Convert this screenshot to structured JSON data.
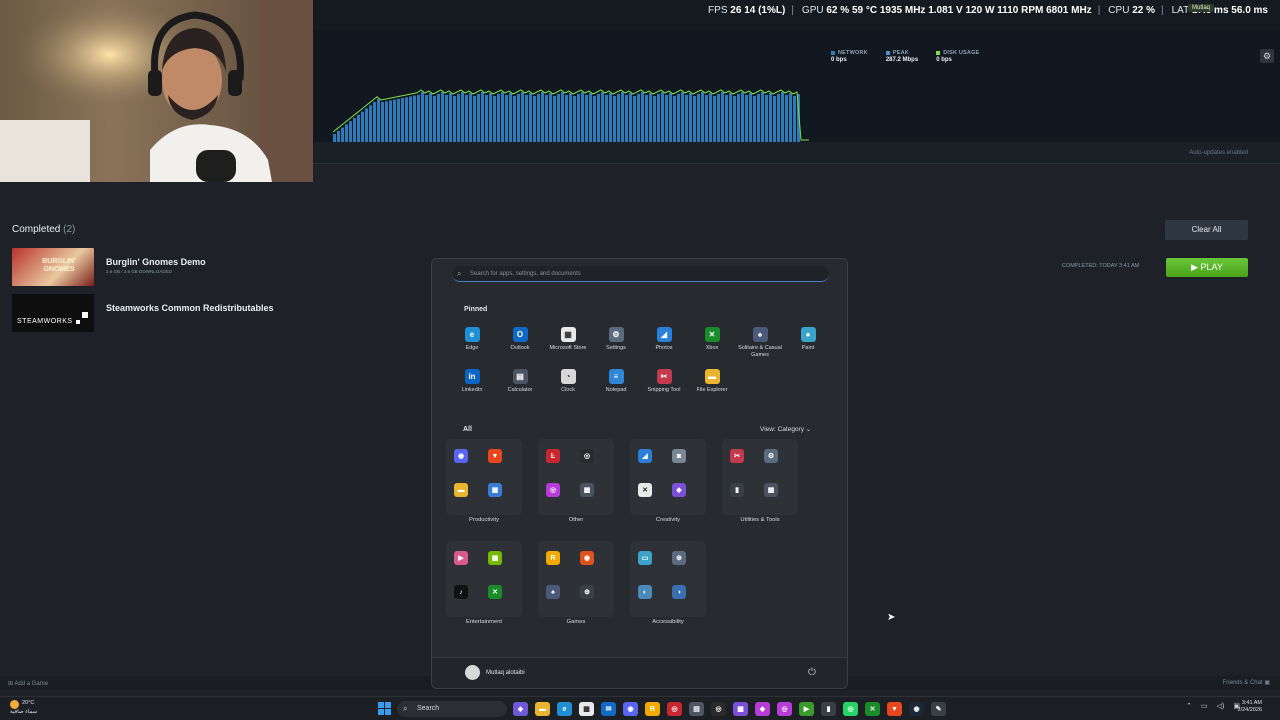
{
  "overlay": {
    "fps_label": "FPS",
    "fps_value": "26",
    "fps_low": "14 (1%L)",
    "gpu_label": "GPU",
    "gpu_usage": "62 %",
    "gpu_temp": "59 °C",
    "gpu_clock": "1935 MHz",
    "gpu_volt": "1.081 V",
    "gpu_power": "120 W",
    "gpu_fan": "1110 RPM",
    "gpu_mem": "6801 MHz",
    "cpu_label": "CPU",
    "cpu_usage": "22 %",
    "lat_label": "LAT",
    "lat_1": "17.8 ms",
    "lat_2": "56.0 ms",
    "user_badge": "Mutlaq"
  },
  "stats": {
    "network_label": "NETWORK",
    "network_value": "0 bps",
    "peak_label": "PEAK",
    "peak_value": "287.2 Mbps",
    "disk_label": "DISK USAGE",
    "disk_value": "0 bps",
    "auto_updates": "Auto-updates enabled"
  },
  "downloads": {
    "completed_label": "Completed",
    "completed_count": "(2)",
    "clear_all": "Clear All",
    "completed_time": "COMPLETED: TODAY 3:41 AM",
    "play_label": "PLAY",
    "items": [
      {
        "name": "Burglin' Gnomes Demo",
        "size": "2.6 GB / 2.6 GB DOWNLOADED",
        "thumb_text": "BURGLIN' GNOMES"
      },
      {
        "name": "Steamworks Common Redistributables",
        "size": "",
        "thumb_text": "STEAMWORKS"
      }
    ],
    "add_game": "Add a Game",
    "friends_chat": "Friends & Chat"
  },
  "start_menu": {
    "search_placeholder": "Search for apps, settings, and documents",
    "pinned_label": "Pinned",
    "pinned": [
      {
        "name": "Edge",
        "icon": "edge-icon",
        "color": "#1f8fd6",
        "glyph": "e"
      },
      {
        "name": "Outlook",
        "icon": "outlook-icon",
        "color": "#1169c6",
        "glyph": "O"
      },
      {
        "name": "Microsoft Store",
        "icon": "store-icon",
        "color": "#e8e8e8",
        "glyph": "▦"
      },
      {
        "name": "Settings",
        "icon": "gear-icon",
        "color": "#5a6b80",
        "glyph": "⚙"
      },
      {
        "name": "Photos",
        "icon": "photos-icon",
        "color": "#2a7fd8",
        "glyph": "◢"
      },
      {
        "name": "Xbox",
        "icon": "xbox-icon",
        "color": "#1a8c2a",
        "glyph": "✕"
      },
      {
        "name": "Solitaire & Casual Games",
        "icon": "solitaire-icon",
        "color": "#4a5a7a",
        "glyph": "♠"
      },
      {
        "name": "Paint",
        "icon": "paint-icon",
        "color": "#3aa3c9",
        "glyph": "●"
      },
      {
        "name": "LinkedIn",
        "icon": "linkedin-icon",
        "color": "#0a66c2",
        "glyph": "in"
      },
      {
        "name": "Calculator",
        "icon": "calculator-icon",
        "color": "#4b5563",
        "glyph": "▤"
      },
      {
        "name": "Clock",
        "icon": "clock-icon",
        "color": "#d8d8d8",
        "glyph": "◔"
      },
      {
        "name": "Notepad",
        "icon": "notepad-icon",
        "color": "#2f86d6",
        "glyph": "≡"
      },
      {
        "name": "Snipping Tool",
        "icon": "snipping-icon",
        "color": "#c23a4b",
        "glyph": "✂"
      },
      {
        "name": "File Explorer",
        "icon": "folder-icon",
        "color": "#e9b530",
        "glyph": "▬"
      }
    ],
    "all_label": "All",
    "view_label": "View: Category",
    "categories": [
      {
        "name": "Productivity",
        "apps": [
          {
            "icon": "discord-icon",
            "color": "#5865f2",
            "glyph": "◉"
          },
          {
            "icon": "brave-icon",
            "color": "#e8461d",
            "glyph": "▼"
          },
          {
            "icon": "folder-icon",
            "color": "#e9b530",
            "glyph": "▬"
          },
          {
            "icon": "widgets-icon",
            "color": "#3a7bd5",
            "glyph": "▦"
          }
        ]
      },
      {
        "name": "Other",
        "apps": [
          {
            "icon": "app-red-icon",
            "color": "#c9272f",
            "glyph": "Ŀ"
          },
          {
            "icon": "obs-icon",
            "color": "#2a2a2a",
            "glyph": "◎"
          },
          {
            "icon": "app-purple-icon",
            "color": "#b63bd8",
            "glyph": "◎"
          },
          {
            "icon": "app-grid-icon",
            "color": "#4a5360",
            "glyph": "▩"
          }
        ]
      },
      {
        "name": "Creativity",
        "apps": [
          {
            "icon": "photos-icon",
            "color": "#2a7fd8",
            "glyph": "◢"
          },
          {
            "icon": "camera-icon",
            "color": "#7a8694",
            "glyph": "◙"
          },
          {
            "icon": "capcut-icon",
            "color": "#e8e8e8",
            "glyph": "✕"
          },
          {
            "icon": "clipchamp-icon",
            "color": "#7b4fd8",
            "glyph": "◆"
          }
        ]
      },
      {
        "name": "Utilities & Tools",
        "apps": [
          {
            "icon": "snipping-icon",
            "color": "#c23a4b",
            "glyph": "✂"
          },
          {
            "icon": "gear-icon",
            "color": "#5a6b80",
            "glyph": "⚙"
          },
          {
            "icon": "mouse-icon",
            "color": "#3a3f45",
            "glyph": "▮"
          },
          {
            "icon": "control-icon",
            "color": "#4a5360",
            "glyph": "▦"
          }
        ]
      },
      {
        "name": "Entertainment",
        "apps": [
          {
            "icon": "media-player-icon",
            "color": "#d65a8a",
            "glyph": "▶"
          },
          {
            "icon": "nvidia-icon",
            "color": "#76b900",
            "glyph": "▦"
          },
          {
            "icon": "tiktok-icon",
            "color": "#111111",
            "glyph": "♪"
          },
          {
            "icon": "xbox-icon",
            "color": "#1a8c2a",
            "glyph": "✕"
          }
        ]
      },
      {
        "name": "Games",
        "apps": [
          {
            "icon": "rockstar-icon",
            "color": "#f2a900",
            "glyph": "R"
          },
          {
            "icon": "ea-icon",
            "color": "#e0521c",
            "glyph": "◉"
          },
          {
            "icon": "solitaire-icon",
            "color": "#4a5a7a",
            "glyph": "♠"
          },
          {
            "icon": "controller-icon",
            "color": "#3a3f45",
            "glyph": "⊕"
          }
        ]
      },
      {
        "name": "Accessibility",
        "apps": [
          {
            "icon": "keyboard-icon",
            "color": "#3aa3c9",
            "glyph": "▭"
          },
          {
            "icon": "magnifier-icon",
            "color": "#5a6b80",
            "glyph": "⊕"
          },
          {
            "icon": "narrator-icon",
            "color": "#4a8bb8",
            "glyph": "◐"
          },
          {
            "icon": "voice-access-icon",
            "color": "#3a6fb0",
            "glyph": "◑"
          }
        ]
      }
    ],
    "user_name": "Mutlaq alotaibi"
  },
  "taskbar": {
    "temp": "20°C",
    "weather_text": "سماء صافية",
    "search_label": "Search",
    "time": "3:41 AM",
    "date": "2/24/2026",
    "apps": [
      {
        "icon": "copilot-icon",
        "color": "#6f58d6",
        "glyph": "◈"
      },
      {
        "icon": "folder-icon",
        "color": "#e9b530",
        "glyph": "▬"
      },
      {
        "icon": "edge-icon",
        "color": "#1f8fd6",
        "glyph": "e"
      },
      {
        "icon": "store-icon",
        "color": "#e8e8e8",
        "glyph": "▦"
      },
      {
        "icon": "mail-icon",
        "color": "#1169c6",
        "glyph": "✉"
      },
      {
        "icon": "app-purple-icon",
        "color": "#5865f2",
        "glyph": "◉"
      },
      {
        "icon": "rockstar-icon",
        "color": "#f2a900",
        "glyph": "R"
      },
      {
        "icon": "app-red-icon",
        "color": "#c9272f",
        "glyph": "◎"
      },
      {
        "icon": "calculator-icon",
        "color": "#4b5563",
        "glyph": "▤"
      },
      {
        "icon": "obs-icon",
        "color": "#2a2a2a",
        "glyph": "◎"
      },
      {
        "icon": "grid-icon",
        "color": "#7b4fd8",
        "glyph": "▩"
      },
      {
        "icon": "pen-icon",
        "color": "#b63bd8",
        "glyph": "◆"
      },
      {
        "icon": "media-icon",
        "color": "#b63bd8",
        "glyph": "◎"
      },
      {
        "icon": "play-icon",
        "color": "#3a9a2a",
        "glyph": "▶"
      },
      {
        "icon": "mouse-icon",
        "color": "#3a3f45",
        "glyph": "▮"
      },
      {
        "icon": "whatsapp-icon",
        "color": "#25d366",
        "glyph": "◎"
      },
      {
        "icon": "xbox-icon",
        "color": "#1a8c2a",
        "glyph": "✕"
      },
      {
        "icon": "brave-icon",
        "color": "#e8461d",
        "glyph": "▼"
      },
      {
        "icon": "steam-icon",
        "color": "#1b2838",
        "glyph": "◉"
      },
      {
        "icon": "pen-green-icon",
        "color": "#3a3f45",
        "glyph": "✎"
      }
    ]
  },
  "colors": {
    "accent_green": "#5bba2a",
    "graph_blue": "#2e7bb8",
    "graph_line": "#7ee04a"
  }
}
